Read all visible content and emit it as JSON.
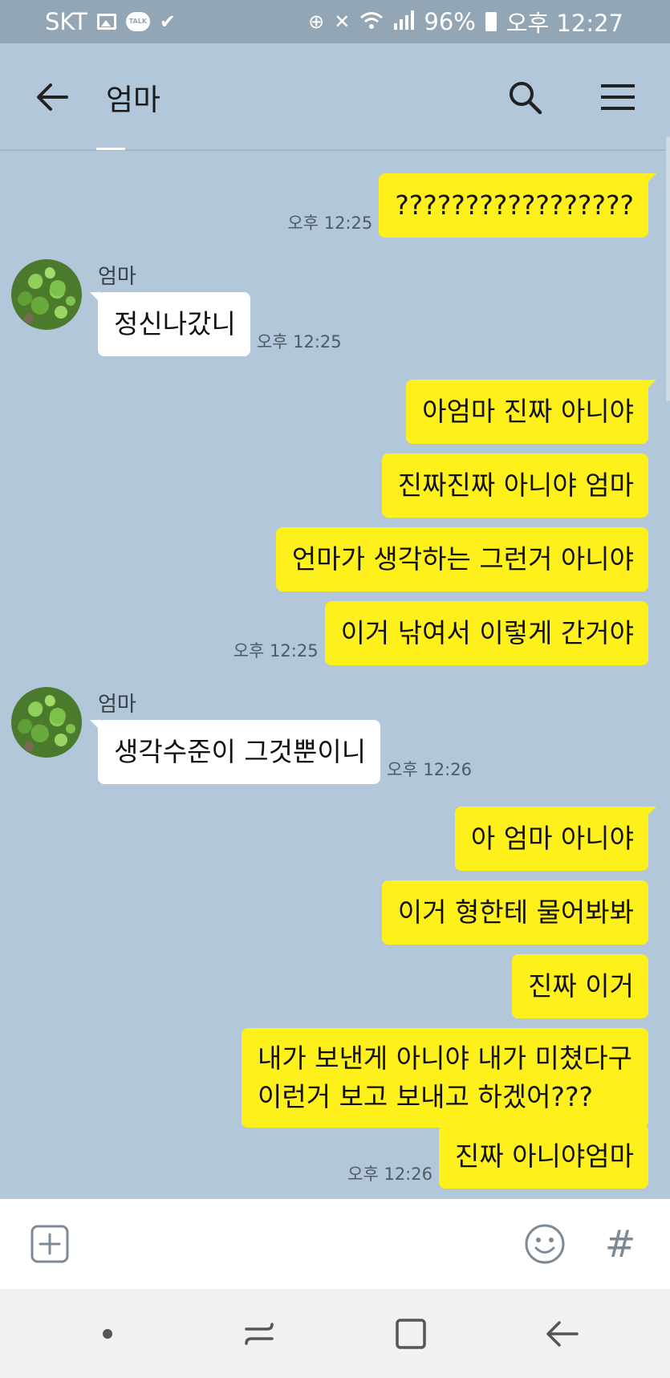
{
  "status_bar": {
    "carrier": "SKT",
    "talk_badge": "TALK",
    "battery": "96%",
    "time": "오후 12:27"
  },
  "header": {
    "title": "엄마"
  },
  "messages": [
    {
      "from": "me",
      "text": "?????????????????",
      "time": "오후 12:25"
    },
    {
      "from": "other",
      "sender": "엄마",
      "text": "정신나갔니",
      "time": "오후 12:25"
    },
    {
      "from": "me",
      "text": "아엄마 진짜 아니야",
      "time": ""
    },
    {
      "from": "me",
      "text": "진짜진짜 아니야 엄마",
      "time": ""
    },
    {
      "from": "me",
      "text": "언마가 생각하는 그런거 아니야",
      "time": ""
    },
    {
      "from": "me",
      "text": "이거 낚여서 이렇게 간거야",
      "time": "오후 12:25"
    },
    {
      "from": "other",
      "sender": "엄마",
      "text": "생각수준이 그것뿐이니",
      "time": "오후 12:26"
    },
    {
      "from": "me",
      "text": "아 엄마 아니야",
      "time": ""
    },
    {
      "from": "me",
      "text": "이거 형한테 물어봐봐",
      "time": ""
    },
    {
      "from": "me",
      "text": "진짜 이거",
      "time": ""
    },
    {
      "from": "me",
      "text": "내가 보낸게 아니야 내가 미쳤다구\n이런거 보고 보내고 하겠어???",
      "time": ""
    },
    {
      "from": "me",
      "text": "진짜 아니야엄마",
      "time": "오후 12:26"
    }
  ],
  "input": {
    "value": "",
    "placeholder": ""
  },
  "icons": {
    "back": "arrow-left-icon",
    "search": "search-icon",
    "menu": "hamburger-menu-icon",
    "attach": "plus-square-icon",
    "emoji": "smiley-icon",
    "hashtag": "#",
    "nav_dot": "dot-icon",
    "nav_recent": "recent-apps-icon",
    "nav_home": "home-icon",
    "nav_back": "nav-back-icon"
  },
  "colors": {
    "chat_background": "#b2c7d9",
    "my_bubble": "#fef01b",
    "other_bubble": "#ffffff",
    "status_bar": "#93a6b5"
  }
}
